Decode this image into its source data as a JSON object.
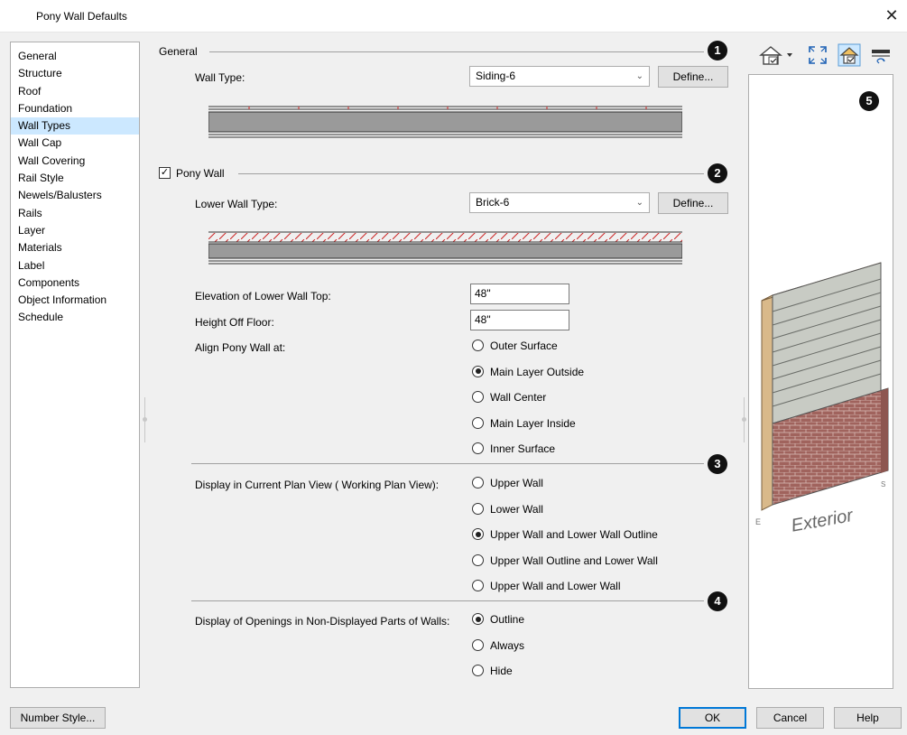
{
  "window": {
    "title": "Pony Wall Defaults",
    "close_glyph": "✕"
  },
  "categories": [
    "General",
    "Structure",
    "Roof",
    "Foundation",
    "Wall Types",
    "Wall Cap",
    "Wall Covering",
    "Rail Style",
    "Newels/Balusters",
    "Rails",
    "Layer",
    "Materials",
    "Label",
    "Components",
    "Object Information",
    "Schedule"
  ],
  "selected_category": "Wall Types",
  "general": {
    "group_label": "General",
    "badge": "1",
    "wall_type_label": "Wall Type:",
    "wall_type_value": "Siding-6",
    "define_label": "Define..."
  },
  "pony": {
    "checkbox_label": "Pony Wall",
    "checked": true,
    "badge": "2",
    "lower_wall_type_label": "Lower Wall Type:",
    "lower_wall_type_value": "Brick-6",
    "define_label": "Define...",
    "elev_label": "Elevation of Lower Wall Top:",
    "elev_value": "48\"",
    "height_label": "Height Off Floor:",
    "height_value": "48\"",
    "align_label": "Align Pony Wall at:",
    "align_options": [
      "Outer Surface",
      "Main Layer Outside",
      "Wall Center",
      "Main Layer Inside",
      "Inner Surface"
    ],
    "align_selected": 1
  },
  "display": {
    "badge": "3",
    "label": "Display in Current Plan View ( Working Plan View):",
    "options": [
      "Upper Wall",
      "Lower Wall",
      "Upper Wall and Lower Wall Outline",
      "Upper Wall Outline and Lower Wall",
      "Upper Wall and Lower Wall"
    ],
    "selected": 2
  },
  "openings": {
    "badge": "4",
    "label": "Display of Openings in Non-Displayed Parts of Walls:",
    "options": [
      "Outline",
      "Always",
      "Hide"
    ],
    "selected": 0
  },
  "preview": {
    "badge": "5",
    "exterior_text": "Exterior",
    "left_marker": "E",
    "right_marker": "S"
  },
  "buttons": {
    "number_style": "Number Style...",
    "ok": "OK",
    "cancel": "Cancel",
    "help": "Help"
  },
  "colors": {
    "selection": "#cce8ff",
    "siding": "#c8cbc4",
    "brick": "#a0635d",
    "stud": "#d9b98a",
    "hatch": "#cc2222"
  }
}
